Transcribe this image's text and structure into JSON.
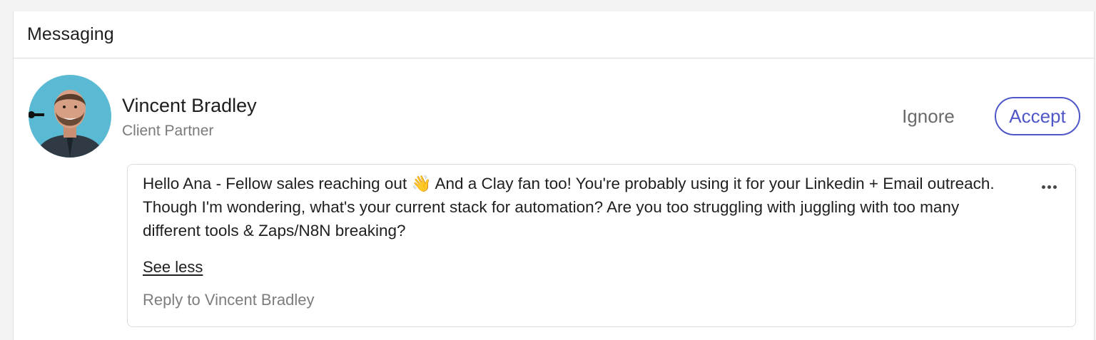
{
  "header": {
    "title": "Messaging"
  },
  "invitation": {
    "sender_name": "Vincent Bradley",
    "sender_role": "Client Partner",
    "ignore_label": "Ignore",
    "accept_label": "Accept",
    "message": "Hello Ana - Fellow sales reaching out 👋 And a Clay fan too! You're probably using it for your Linkedin + Email outreach. Though I'm wondering, what's your current stack for automation? Are you too struggling with juggling with too many different tools & Zaps/N8N breaking?",
    "see_less_label": "See less",
    "reply_label": "Reply to Vincent Bradley",
    "more_icon": "more-horizontal-icon"
  },
  "colors": {
    "accent": "#4e56c8",
    "avatar_background": "#5bbad3"
  }
}
